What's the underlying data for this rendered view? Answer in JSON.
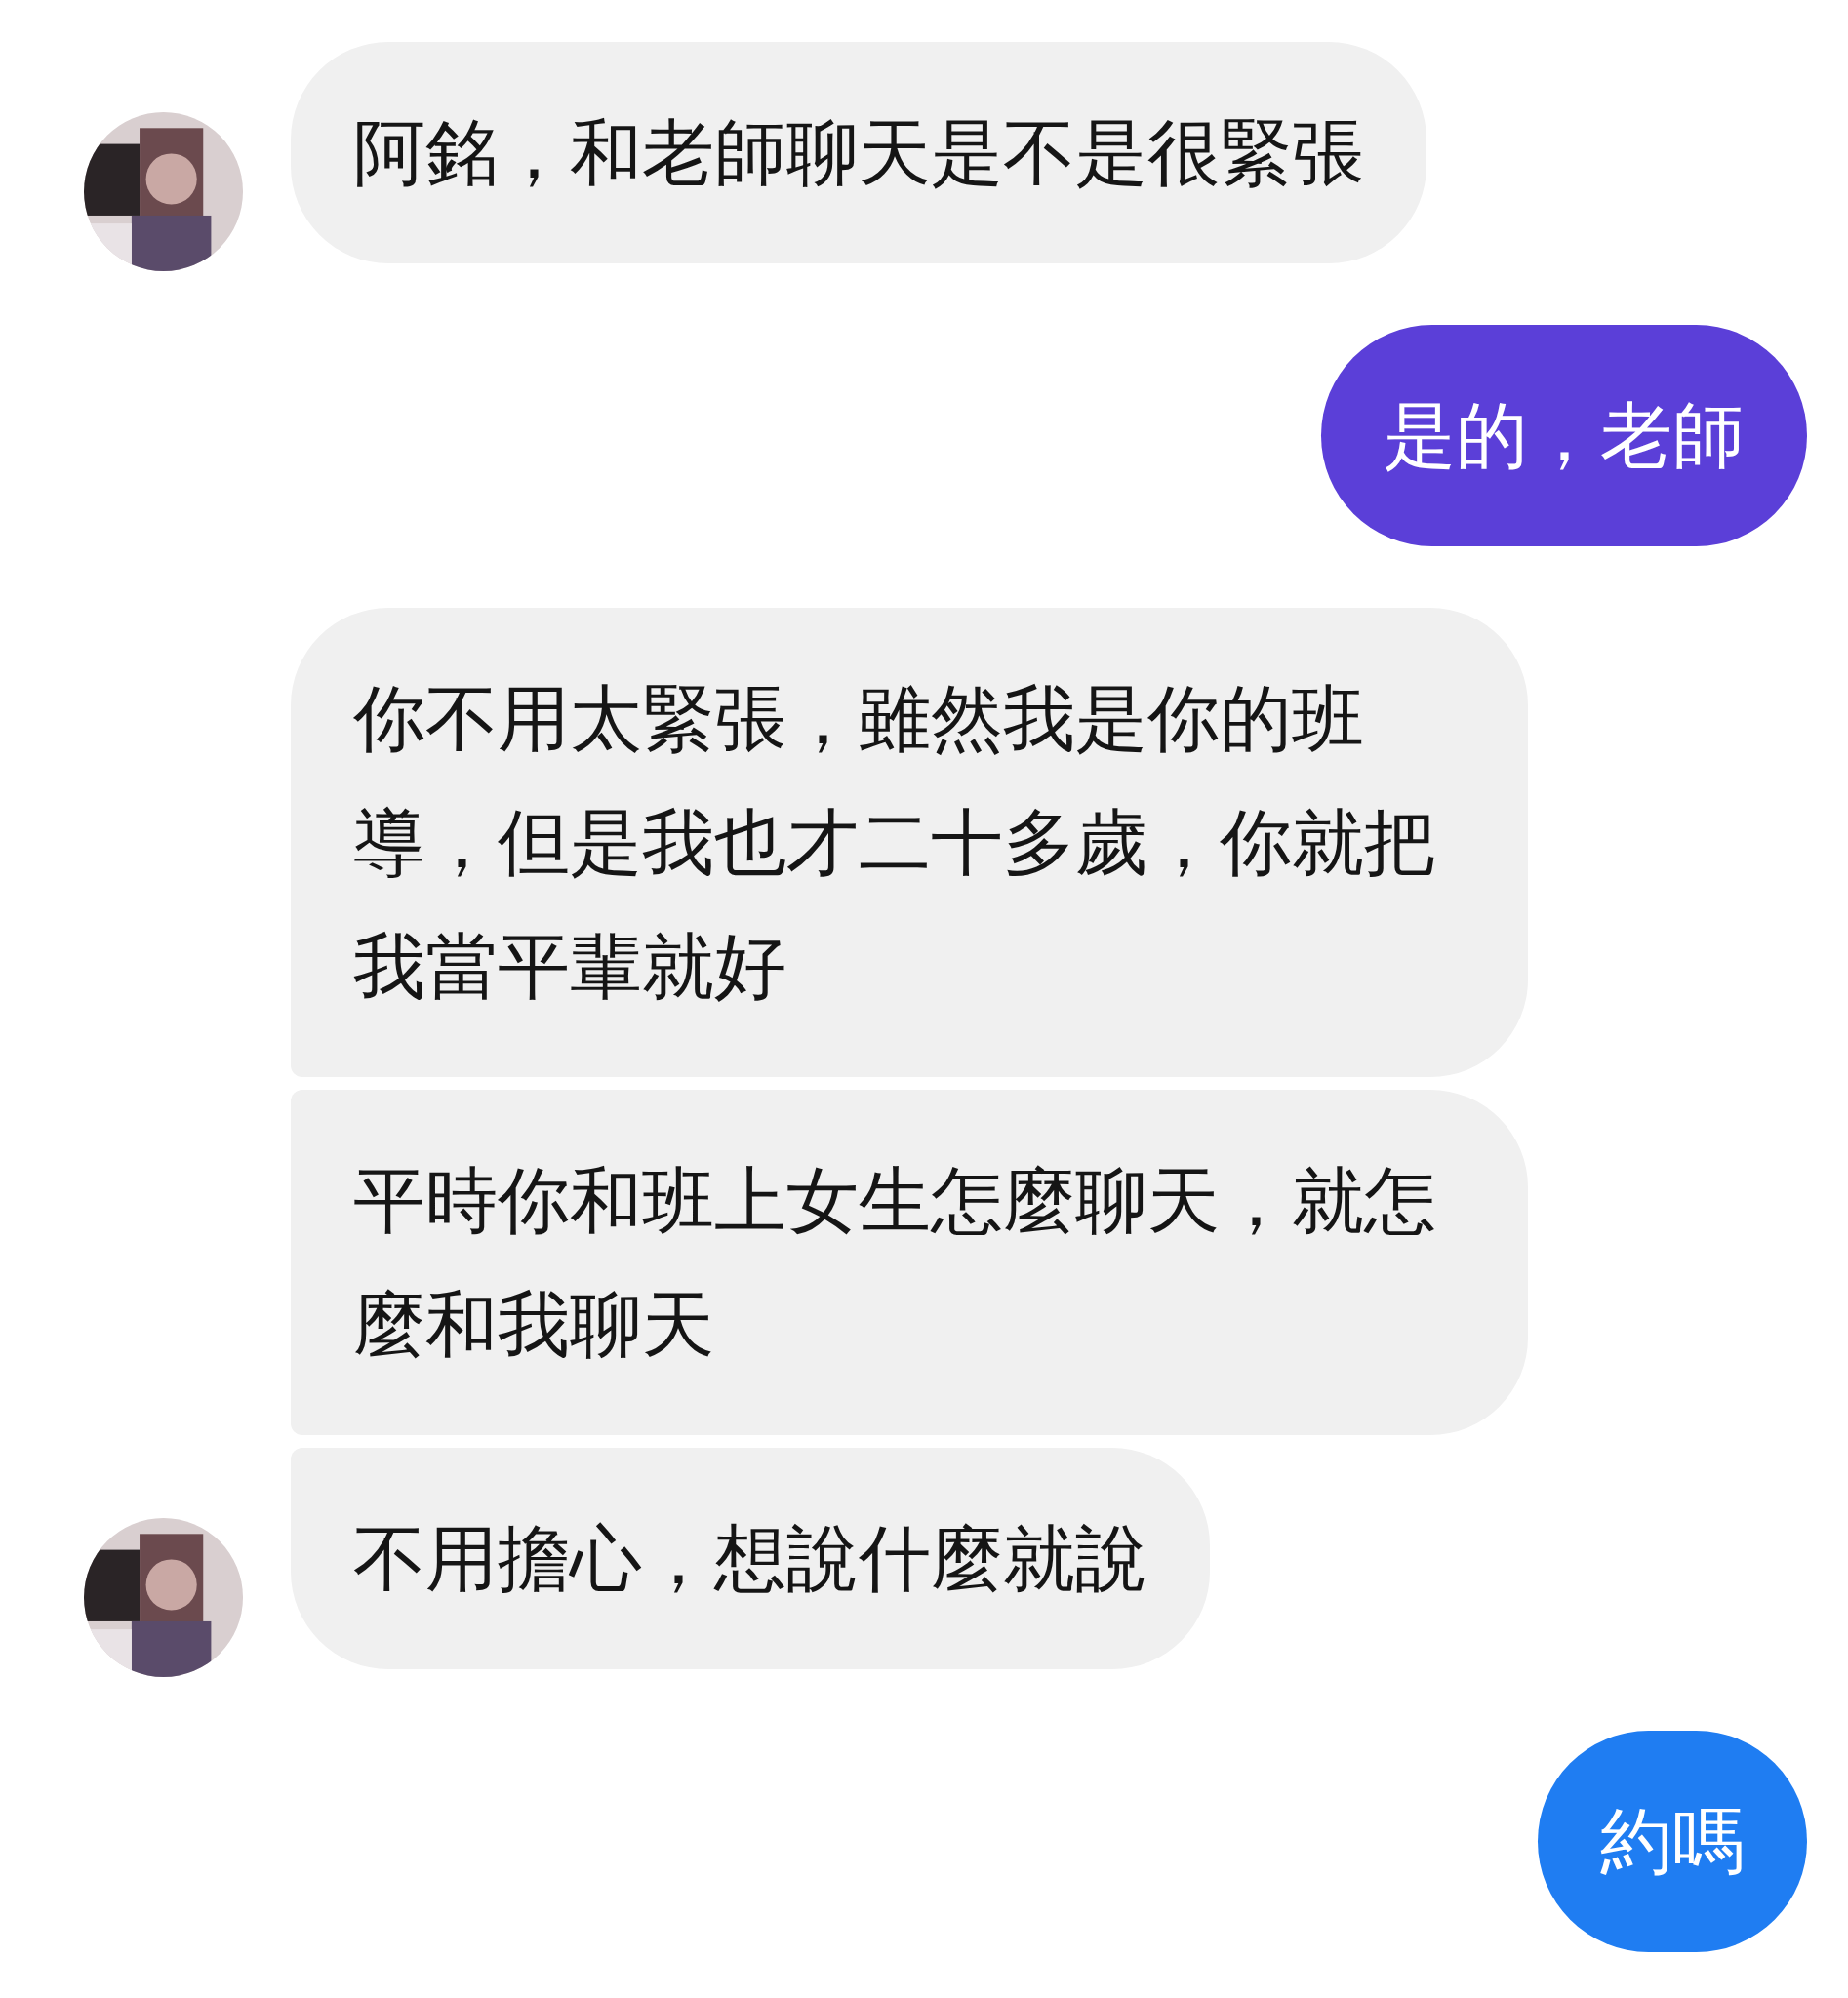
{
  "messages": [
    {
      "kind": "incoming",
      "avatar": true,
      "text": "阿銘，和老師聊天是不是很緊張"
    },
    {
      "kind": "outgoing",
      "color": "#5b3fd8",
      "text": "是的，老師"
    },
    {
      "kind": "incoming",
      "avatar": false,
      "text": "你不用太緊張，雖然我是你的班導，但是我也才二十多歲，你就把我當平輩就好"
    },
    {
      "kind": "incoming",
      "avatar": false,
      "text": "平時你和班上女生怎麼聊天，就怎麼和我聊天"
    },
    {
      "kind": "incoming",
      "avatar": true,
      "text": "不用擔心，想說什麼就說"
    },
    {
      "kind": "outgoing",
      "color": "#1f7df2",
      "text": "約嗎"
    }
  ]
}
